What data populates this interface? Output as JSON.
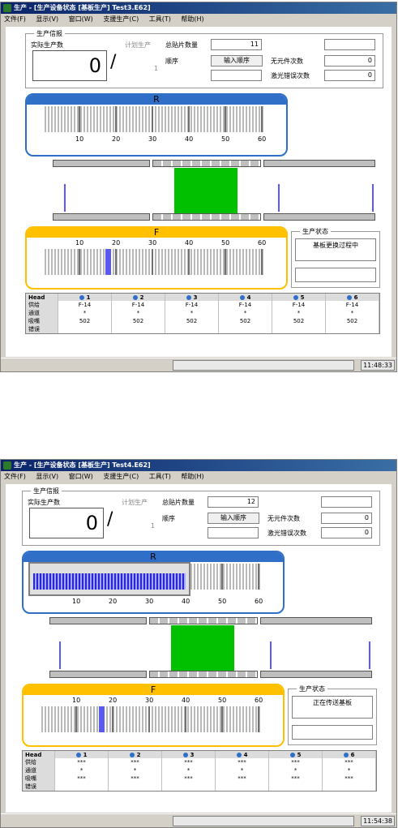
{
  "windows": [
    {
      "title": "生产 - [生产设备状态 [基板生产] Test3.E62]",
      "menu": [
        "文件(F)",
        "显示(V)",
        "窗口(W)",
        "支援生产(C)",
        "工具(T)",
        "帮助(H)"
      ],
      "info": {
        "section": "生产信报",
        "actual_label": "实际生产数",
        "actual_value": "0",
        "plan_label": "计划生产",
        "plan_value": "1",
        "total_label": "总贴片数量",
        "total_value": "11",
        "order_label": "顺序",
        "order_button": "输入顺序",
        "missing_label": "无元件次数",
        "missing_value": "0",
        "laser_label": "激光错误次数",
        "laser_value": "0"
      },
      "r_panel": {
        "label": "R",
        "scale": [
          "10",
          "20",
          "30",
          "40",
          "50",
          "60"
        ]
      },
      "f_panel": {
        "label": "F",
        "scale": [
          "10",
          "20",
          "30",
          "40",
          "50",
          "60"
        ],
        "highlight_slot": 18
      },
      "status": {
        "title": "生产状态",
        "message": "基板更换过程中"
      },
      "table": {
        "head_label": "Head",
        "heads": [
          "1",
          "2",
          "3",
          "4",
          "5",
          "6"
        ],
        "rows": [
          {
            "label": "供给",
            "values": [
              "F-14",
              "F-14",
              "F-14",
              "F-14",
              "F-14",
              "F-14"
            ]
          },
          {
            "label": "通道",
            "values": [
              "*",
              "*",
              "*",
              "*",
              "*",
              "*"
            ]
          },
          {
            "label": "吸嘴",
            "values": [
              "502",
              "502",
              "502",
              "502",
              "502",
              "502"
            ]
          },
          {
            "label": "错误",
            "values": [
              "",
              "",
              "",
              "",
              "",
              ""
            ]
          }
        ]
      },
      "clock": "11:48:33"
    },
    {
      "title": "生产 - [生产设备状态 [基板生产] Test4.E62]",
      "menu": [
        "文件(F)",
        "显示(V)",
        "窗口(W)",
        "支援生产(C)",
        "工具(T)",
        "帮助(H)"
      ],
      "info": {
        "section": "生产信报",
        "actual_label": "实际生产数",
        "actual_value": "0",
        "plan_label": "计划生产",
        "plan_value": "1",
        "total_label": "总贴片数量",
        "total_value": "12",
        "order_label": "顺序",
        "order_button": "输入顺序",
        "missing_label": "无元件次数",
        "missing_value": "0",
        "laser_label": "激光错误次数",
        "laser_value": "0"
      },
      "r_panel": {
        "label": "R",
        "scale": [
          "10",
          "20",
          "30",
          "40",
          "50",
          "60"
        ]
      },
      "f_panel": {
        "label": "F",
        "scale": [
          "10",
          "20",
          "30",
          "40",
          "50",
          "60"
        ],
        "highlight_slot": 17
      },
      "status": {
        "title": "生产状态",
        "message": "正在传送基板"
      },
      "table": {
        "head_label": "Head",
        "heads": [
          "1",
          "2",
          "3",
          "4",
          "5",
          "6"
        ],
        "rows": [
          {
            "label": "供给",
            "values": [
              "***",
              "***",
              "***",
              "***",
              "***",
              "***"
            ]
          },
          {
            "label": "通道",
            "values": [
              "*",
              "*",
              "*",
              "*",
              "*",
              "*"
            ]
          },
          {
            "label": "吸嘴",
            "values": [
              "***",
              "***",
              "***",
              "***",
              "***",
              "***"
            ]
          },
          {
            "label": "错误",
            "values": [
              "",
              "",
              "",
              "",
              "",
              ""
            ]
          }
        ]
      },
      "clock": "11:54:38"
    }
  ],
  "colors": {
    "titlebar": "#0a246a",
    "rear": "#2f6fc8",
    "front": "#ffc000",
    "board": "#00c000",
    "head_marker": "#5a5af0"
  }
}
